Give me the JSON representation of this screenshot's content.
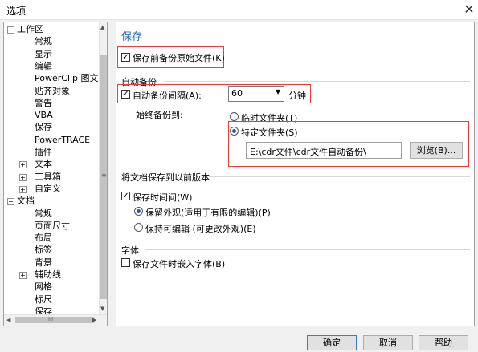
{
  "window": {
    "title": "选项",
    "close_glyph": "✕"
  },
  "tree": {
    "items": [
      {
        "label": "工作区",
        "level": 0,
        "expander": "−"
      },
      {
        "label": "常规",
        "level": 1
      },
      {
        "label": "显示",
        "level": 1
      },
      {
        "label": "编辑",
        "level": 1
      },
      {
        "label": "PowerClip 图文框",
        "level": 1
      },
      {
        "label": "贴齐对象",
        "level": 1
      },
      {
        "label": "警告",
        "level": 1
      },
      {
        "label": "VBA",
        "level": 1
      },
      {
        "label": "保存",
        "level": 1
      },
      {
        "label": "PowerTRACE",
        "level": 1
      },
      {
        "label": "插件",
        "level": 1
      },
      {
        "label": "文本",
        "level": 1,
        "expander": "+"
      },
      {
        "label": "工具箱",
        "level": 1,
        "expander": "+"
      },
      {
        "label": "自定义",
        "level": 1,
        "expander": "+"
      },
      {
        "label": "文档",
        "level": 0,
        "expander": "−"
      },
      {
        "label": "常规",
        "level": 1
      },
      {
        "label": "页面尺寸",
        "level": 1
      },
      {
        "label": "布局",
        "level": 1
      },
      {
        "label": "标签",
        "level": 1
      },
      {
        "label": "背景",
        "level": 1
      },
      {
        "label": "辅助线",
        "level": 1,
        "expander": "+"
      },
      {
        "label": "网格",
        "level": 1
      },
      {
        "label": "标尺",
        "level": 1
      },
      {
        "label": "保存",
        "level": 1
      }
    ],
    "scroll_grip": "≡",
    "h_grip": "III"
  },
  "panel": {
    "title": "保存",
    "backup_before_save": "保存前备份原始文件(K)",
    "auto_backup_group": "自动备份",
    "auto_backup_interval": "自动备份间隔(A):",
    "interval_value": "60",
    "interval_unit": "分钟",
    "always_backup_to": "始终备份到:",
    "temp_folder": "临时文件夹(T)",
    "specific_folder": "特定文件夹(S)",
    "folder_path": "E:\\cdr文件\\cdr文件自动备份\\",
    "browse_button": "浏览(B)...",
    "save_as_group": "将文档保存到以前版本",
    "save_time": "保存时间问(W)",
    "keep_appearance": "保留外观(适用于有限的编辑)(P)",
    "keep_editable": "保持可编辑 (可更改外观)(E)",
    "font_group": "字体",
    "embed_fonts": "保存文件时嵌入字体(B)"
  },
  "footer": {
    "ok": "确定",
    "cancel": "取消",
    "help": "帮助"
  },
  "colors": {
    "accent_title": "#2c6bb8",
    "highlight_box": "#e04040"
  }
}
